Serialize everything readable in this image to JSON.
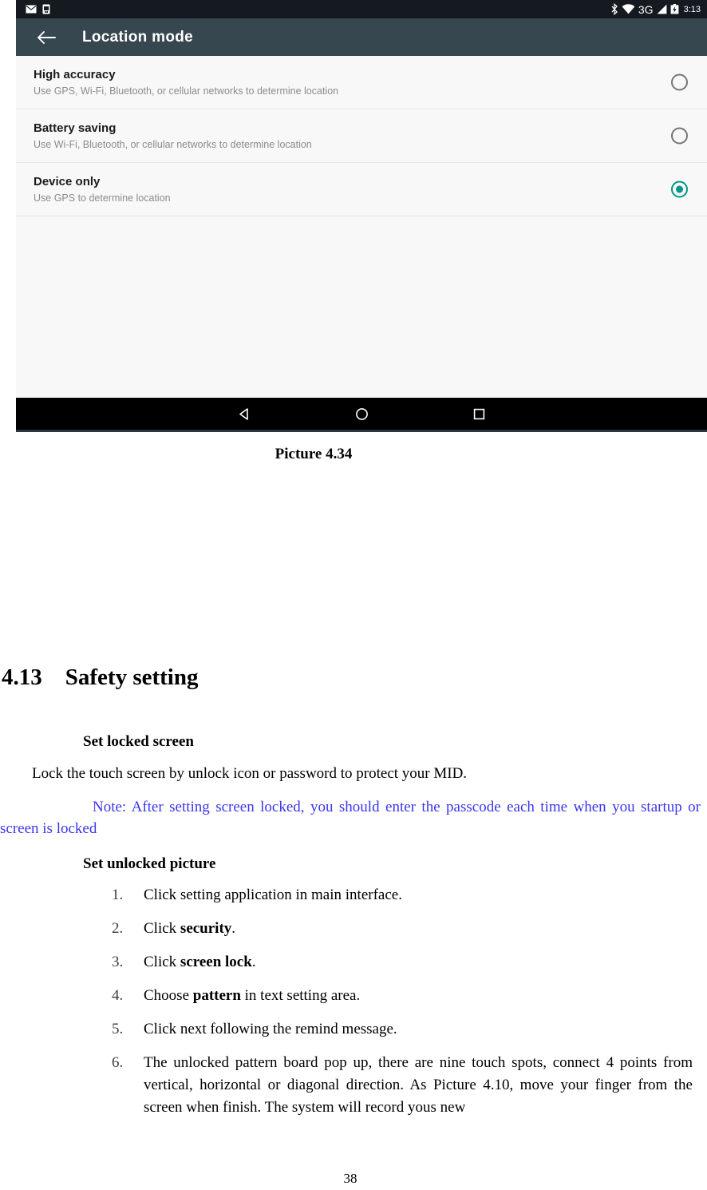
{
  "screenshot": {
    "statusbar": {
      "left_icons": [
        "mail-icon",
        "sim-card-icon"
      ],
      "right_icons": [
        "bluetooth-icon",
        "wifi-icon",
        "signal-3g-icon",
        "cellular-signal-icon",
        "battery-icon"
      ],
      "network_label": "3G",
      "time": "3:13",
      "background_color": "#141a1f"
    },
    "toolbar": {
      "back_icon": "back-arrow-icon",
      "title": "Location mode",
      "background_color": "#37474f"
    },
    "location_modes": [
      {
        "title": "High accuracy",
        "subtitle": "Use GPS, Wi-Fi, Bluetooth, or cellular networks to determine location",
        "selected": false
      },
      {
        "title": "Battery saving",
        "subtitle": "Use Wi-Fi, Bluetooth, or cellular networks to determine location",
        "selected": false
      },
      {
        "title": "Device only",
        "subtitle": "Use GPS to determine location",
        "selected": true
      }
    ],
    "accent_color": "#009688",
    "navbar": {
      "buttons": [
        "back-triangle-icon",
        "home-circle-icon",
        "recents-square-icon"
      ],
      "background_color": "#000000"
    }
  },
  "figure": {
    "caption": "Picture 4.34"
  },
  "document": {
    "section_number": "4.13",
    "section_title": "Safety setting",
    "heading_full": "4.13    Safety setting",
    "sub_heading_1": "Set locked screen",
    "paragraph_1": "Lock the touch screen by unlock icon or password to protect your MID.",
    "note_color": "#3a36ef",
    "note_text": "Note: After setting screen locked, you should enter the passcode each time when you startup or screen is locked",
    "sub_heading_2": "Set unlocked picture",
    "steps": [
      {
        "num": "1.",
        "parts": [
          {
            "text": "Click setting application in main interface.",
            "bold": false
          }
        ]
      },
      {
        "num": "2.",
        "parts": [
          {
            "text": "Click ",
            "bold": false
          },
          {
            "text": "security",
            "bold": true
          },
          {
            "text": ".",
            "bold": false
          }
        ]
      },
      {
        "num": "3.",
        "parts": [
          {
            "text": "Click   ",
            "bold": false
          },
          {
            "text": "screen lock",
            "bold": true
          },
          {
            "text": ".",
            "bold": false
          }
        ]
      },
      {
        "num": "4.",
        "parts": [
          {
            "text": "Choose ",
            "bold": false
          },
          {
            "text": "pattern",
            "bold": true
          },
          {
            "text": " in text setting area.",
            "bold": false
          }
        ]
      },
      {
        "num": "5.",
        "parts": [
          {
            "text": "Click next following the remind message.",
            "bold": false
          }
        ]
      },
      {
        "num": "6.",
        "parts": [
          {
            "text": "The unlocked pattern board pop up, there are nine touch spots, connect 4 points from vertical, horizontal or diagonal direction. As Picture 4.10, move your finger from the screen when finish. The system will record yous new",
            "bold": false
          }
        ]
      }
    ],
    "page_number": "38"
  }
}
